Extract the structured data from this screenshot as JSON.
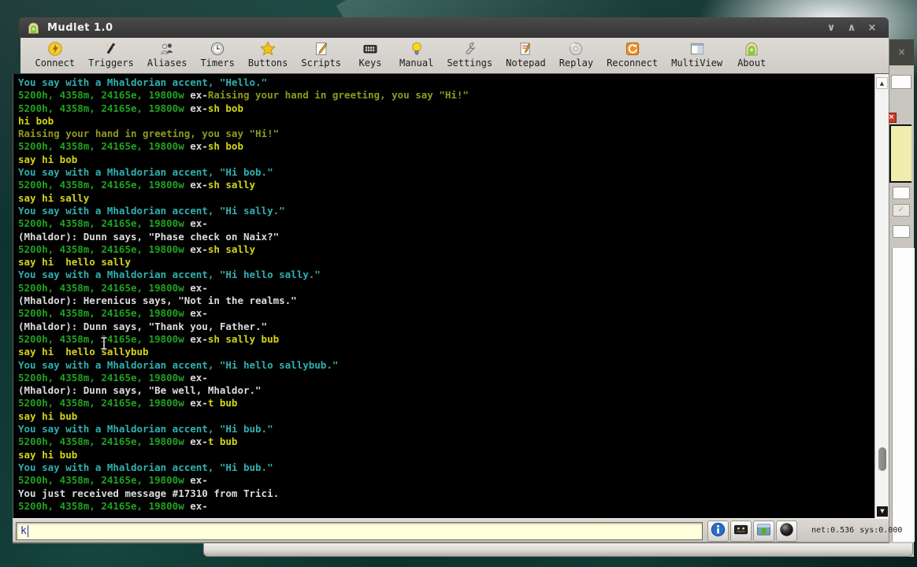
{
  "window": {
    "title": "Mudlet 1.0",
    "minimize_label": "∨",
    "maximize_label": "∧",
    "close_label": "×"
  },
  "toolbar": {
    "items": [
      {
        "label": "Connect",
        "icon": "connect-icon"
      },
      {
        "label": "Triggers",
        "icon": "triggers-icon"
      },
      {
        "label": "Aliases",
        "icon": "aliases-icon"
      },
      {
        "label": "Timers",
        "icon": "timers-icon"
      },
      {
        "label": "Buttons",
        "icon": "buttons-icon"
      },
      {
        "label": "Scripts",
        "icon": "scripts-icon"
      },
      {
        "label": "Keys",
        "icon": "keys-icon"
      },
      {
        "label": "Manual",
        "icon": "manual-icon"
      },
      {
        "label": "Settings",
        "icon": "settings-icon"
      },
      {
        "label": "Notepad",
        "icon": "notepad-icon"
      },
      {
        "label": "Replay",
        "icon": "replay-icon"
      },
      {
        "label": "Reconnect",
        "icon": "reconnect-icon"
      },
      {
        "label": "MultiView",
        "icon": "multiview-icon"
      },
      {
        "label": "About",
        "icon": "about-icon"
      }
    ]
  },
  "terminal": {
    "palette": {
      "prompt": "#21a221",
      "plain": "#dcdcdc",
      "cmd": "#d4d41c",
      "echo": "#8f9a20",
      "say": "#2fb0b0"
    },
    "lines": [
      [
        [
          "say",
          "You say with a Mhaldorian accent, \"Hello.\""
        ]
      ],
      [
        [
          "prompt",
          "5200h, 4358m, 24165e, 19800w "
        ],
        [
          "plain",
          "ex-"
        ],
        [
          "echo",
          "Raising your hand in greeting, you say \"Hi!\""
        ]
      ],
      [
        [
          "prompt",
          "5200h, 4358m, 24165e, 19800w "
        ],
        [
          "plain",
          "ex-"
        ],
        [
          "cmd",
          "sh bob"
        ]
      ],
      [
        [
          "cmd",
          "hi bob"
        ]
      ],
      [
        [
          "echo",
          "Raising your hand in greeting, you say \"Hi!\""
        ]
      ],
      [
        [
          "prompt",
          "5200h, 4358m, 24165e, 19800w "
        ],
        [
          "plain",
          "ex-"
        ],
        [
          "cmd",
          "sh bob"
        ]
      ],
      [
        [
          "cmd",
          "say hi bob"
        ]
      ],
      [
        [
          "say",
          "You say with a Mhaldorian accent, \"Hi bob.\""
        ]
      ],
      [
        [
          "prompt",
          "5200h, 4358m, 24165e, 19800w "
        ],
        [
          "plain",
          "ex-"
        ],
        [
          "cmd",
          "sh sally"
        ]
      ],
      [
        [
          "cmd",
          "say hi sally"
        ]
      ],
      [
        [
          "say",
          "You say with a Mhaldorian accent, \"Hi sally.\""
        ]
      ],
      [
        [
          "prompt",
          "5200h, 4358m, 24165e, 19800w "
        ],
        [
          "plain",
          "ex-"
        ]
      ],
      [
        [
          "plain",
          "(Mhaldor): Dunn says, \"Phase check on Naix?\""
        ]
      ],
      [
        [
          "prompt",
          "5200h, 4358m, 24165e, 19800w "
        ],
        [
          "plain",
          "ex-"
        ],
        [
          "cmd",
          "sh sally"
        ]
      ],
      [
        [
          "cmd",
          "say hi  hello sally"
        ]
      ],
      [
        [
          "say",
          "You say with a Mhaldorian accent, \"Hi hello sally.\""
        ]
      ],
      [
        [
          "prompt",
          "5200h, 4358m, 24165e, 19800w "
        ],
        [
          "plain",
          "ex-"
        ]
      ],
      [
        [
          "plain",
          "(Mhaldor): Herenicus says, \"Not in the realms.\""
        ]
      ],
      [
        [
          "prompt",
          "5200h, 4358m, 24165e, 19800w "
        ],
        [
          "plain",
          "ex-"
        ]
      ],
      [
        [
          "plain",
          "(Mhaldor): Dunn says, \"Thank you, Father.\""
        ]
      ],
      [
        [
          "prompt",
          "5200h, 4358m, 24165e, 19800w "
        ],
        [
          "plain",
          "ex-"
        ],
        [
          "cmd",
          "sh sally bub"
        ]
      ],
      [
        [
          "cmd",
          "say hi  hello sallybub"
        ]
      ],
      [
        [
          "say",
          "You say with a Mhaldorian accent, \"Hi hello sallybub.\""
        ]
      ],
      [
        [
          "prompt",
          "5200h, 4358m, 24165e, 19800w "
        ],
        [
          "plain",
          "ex-"
        ]
      ],
      [
        [
          "plain",
          "(Mhaldor): Dunn says, \"Be well, Mhaldor.\""
        ]
      ],
      [
        [
          "prompt",
          "5200h, 4358m, 24165e, 19800w "
        ],
        [
          "plain",
          "ex-"
        ],
        [
          "cmd",
          "t bub"
        ]
      ],
      [
        [
          "cmd",
          "say hi bub"
        ]
      ],
      [
        [
          "say",
          "You say with a Mhaldorian accent, \"Hi bub.\""
        ]
      ],
      [
        [
          "prompt",
          "5200h, 4358m, 24165e, 19800w "
        ],
        [
          "plain",
          "ex-"
        ],
        [
          "cmd",
          "t bub"
        ]
      ],
      [
        [
          "cmd",
          "say hi bub"
        ]
      ],
      [
        [
          "say",
          "You say with a Mhaldorian accent, \"Hi bub.\""
        ]
      ],
      [
        [
          "prompt",
          "5200h, 4358m, 24165e, 19800w "
        ],
        [
          "plain",
          "ex-"
        ]
      ],
      [
        [
          "plain",
          "You just received message #17310 from Trici."
        ]
      ],
      [
        [
          "prompt",
          "5200h, 4358m, 24165e, 19800w "
        ],
        [
          "plain",
          "ex-"
        ]
      ]
    ]
  },
  "scrollbar": {
    "up_label": "▲",
    "down_label": "▼"
  },
  "command_input": {
    "value": "k"
  },
  "statusbar": {
    "buttons": [
      {
        "name": "info-button",
        "icon": "info-icon"
      },
      {
        "name": "cassette-button",
        "icon": "cassette-icon"
      },
      {
        "name": "screen-button",
        "icon": "screen-icon"
      },
      {
        "name": "sphere-button",
        "icon": "sphere-icon"
      }
    ],
    "net_label": "net:0.536",
    "sys_label": "sys:0.000"
  },
  "background_window": {
    "close_label": "×",
    "check_label": "✓"
  }
}
